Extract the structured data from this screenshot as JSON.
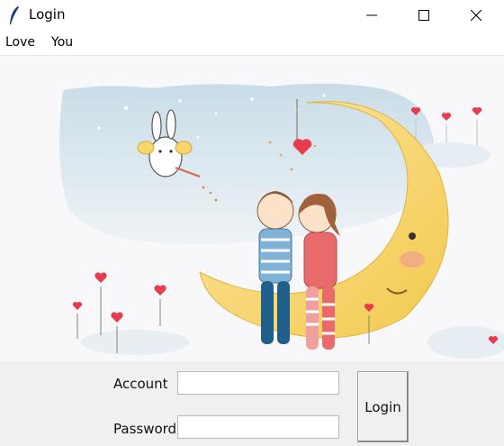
{
  "window": {
    "title": "Login",
    "icon": "feather-icon",
    "controls": [
      "minimize-icon",
      "maximize-icon",
      "close-icon"
    ]
  },
  "menu": {
    "items": [
      {
        "label": "Love"
      },
      {
        "label": "You"
      }
    ]
  },
  "illustration": {
    "subject": "couple-on-moon-illustration",
    "colors": {
      "moon": "#f7d66b",
      "sky": "#cfe3ee",
      "heart": "#e63c4e"
    }
  },
  "form": {
    "account_label": "Account",
    "account_value": "",
    "password_label": "Password",
    "password_value": "",
    "login_label": "Login"
  }
}
